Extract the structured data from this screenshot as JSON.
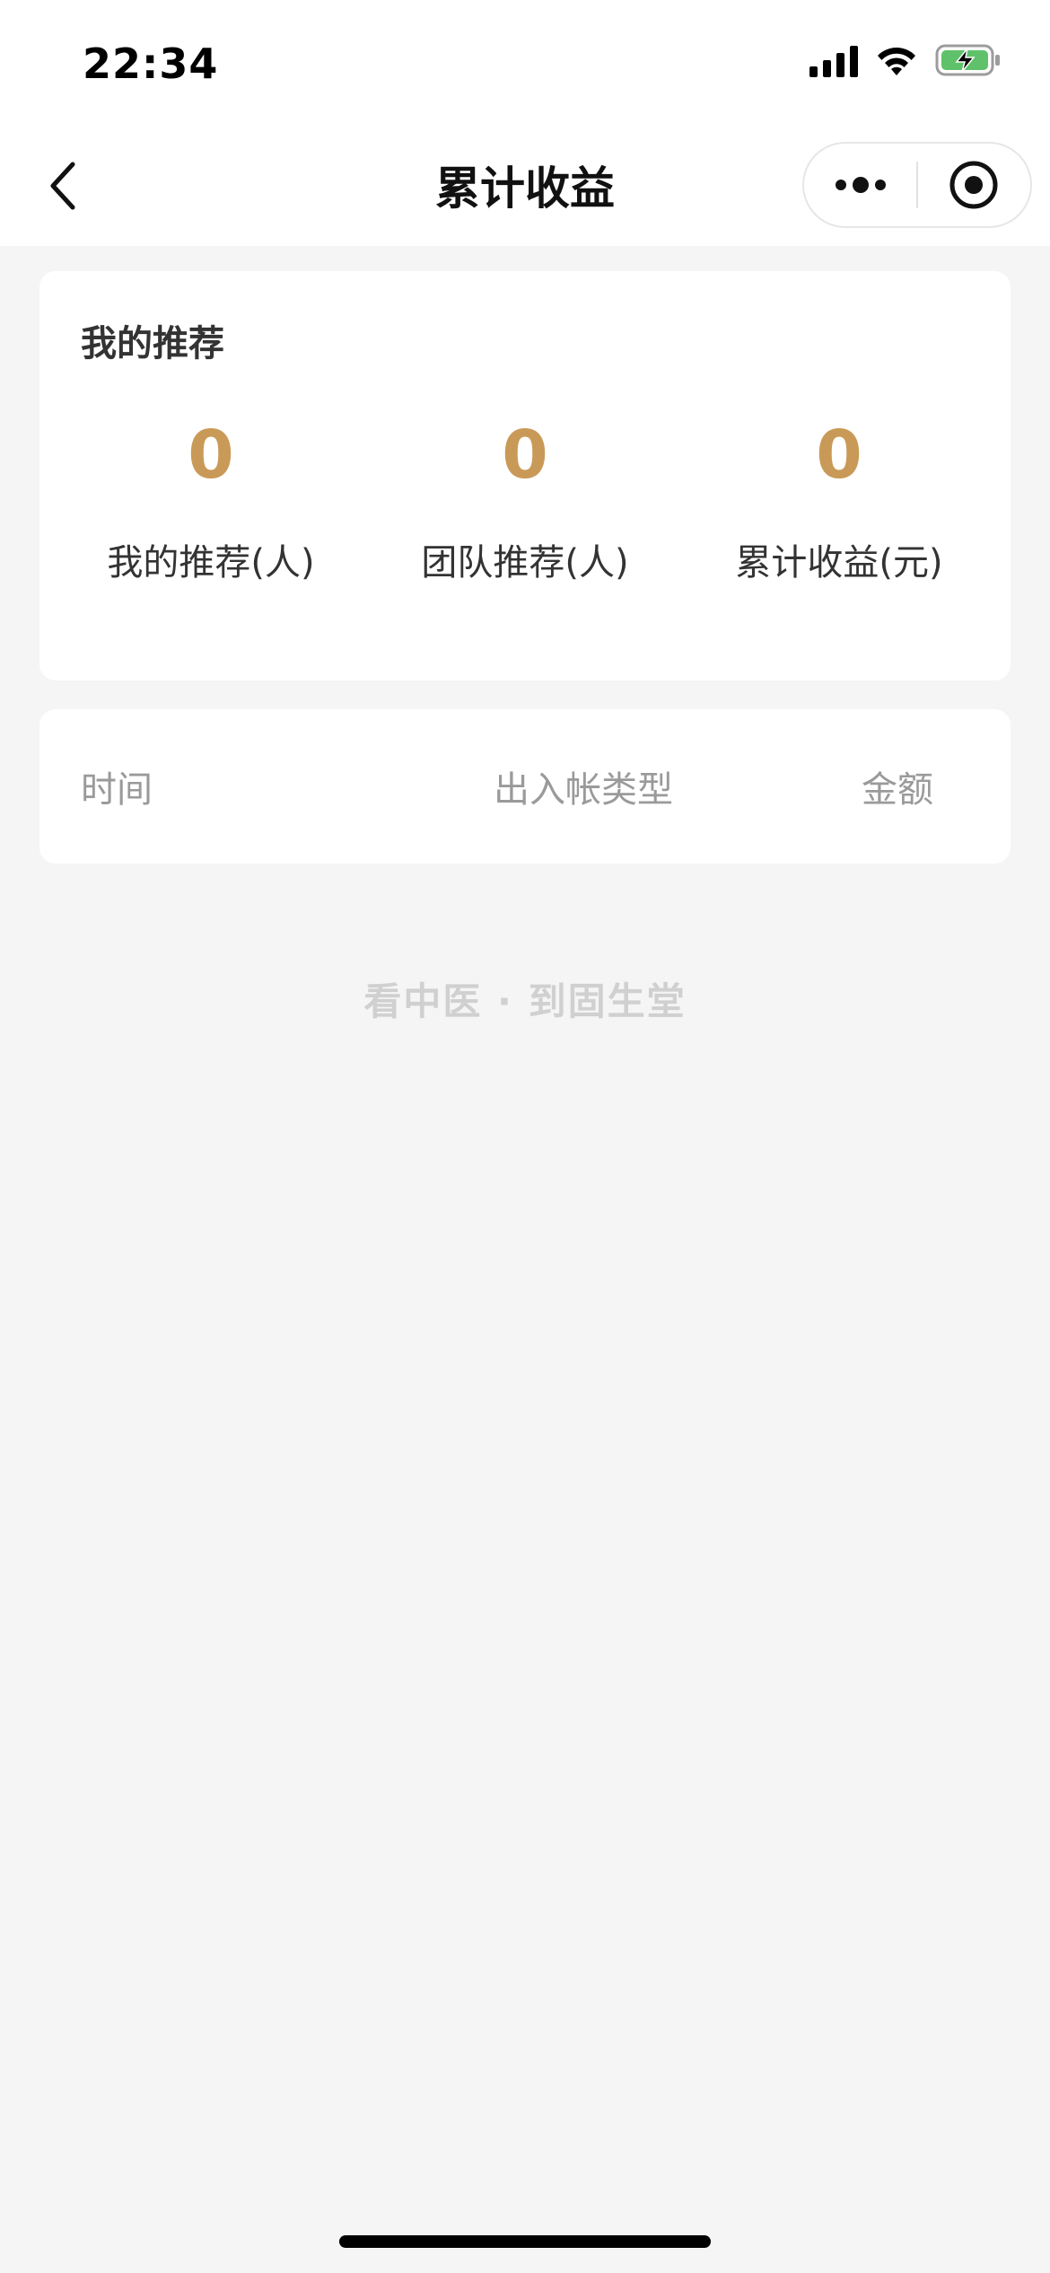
{
  "status_bar": {
    "time": "22:34",
    "icons": [
      "signal-icon",
      "wifi-icon",
      "battery-charging-icon"
    ]
  },
  "nav": {
    "title": "累计收益",
    "back_icon": "chevron-left-icon",
    "more_icon": "more-dots-icon",
    "close_icon": "target-close-icon"
  },
  "stats_card": {
    "title": "我的推荐",
    "stats": [
      {
        "value": "0",
        "label": "我的推荐(人)"
      },
      {
        "value": "0",
        "label": "团队推荐(人)"
      },
      {
        "value": "0",
        "label": "累计收益(元)"
      }
    ]
  },
  "table": {
    "headers": {
      "time": "时间",
      "type": "出入帐类型",
      "amount": "金额"
    }
  },
  "footer": {
    "slogan": "看中医 · 到固生堂"
  },
  "colors": {
    "accent": "#c99a57",
    "background": "#f5f5f5",
    "card": "#ffffff",
    "muted_text": "#9a9a9a",
    "slogan_text": "#d0d0d0"
  }
}
